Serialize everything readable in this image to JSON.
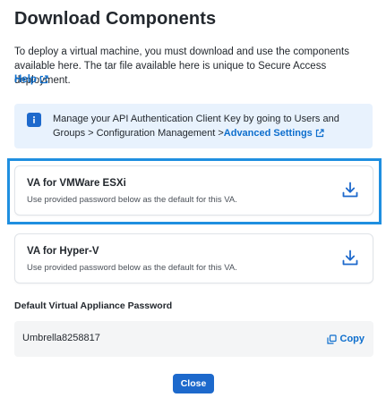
{
  "modal": {
    "title": "Download Components",
    "intro": "To deploy a virtual machine, you must download and use the components available here. The tar file available here is unique to Secure Access deployment.",
    "help_link": "Help"
  },
  "info_banner": {
    "text": "Manage your API Authentication Client Key by going to Users and Groups > Configuration Management >",
    "link": "Advanced Settings"
  },
  "components": [
    {
      "title": "VA for VMWare ESXi",
      "description": "Use provided password below as the default for this VA.",
      "highlighted": true
    },
    {
      "title": "VA for Hyper-V",
      "description": "Use provided password below as the default for this VA.",
      "highlighted": false
    }
  ],
  "password": {
    "label": "Default Virtual Appliance Password",
    "value": "Umbrella8258817",
    "copy_label": "Copy"
  },
  "footer": {
    "close_label": "Close"
  },
  "icons": {
    "info": "info-icon",
    "external_link": "external-link-icon",
    "download": "download-icon",
    "copy": "copy-icon"
  },
  "colors": {
    "accent": "#1d69cc",
    "link": "#0d6ecd",
    "highlight_border": "#1f8fe0",
    "banner_bg": "#e8f2fd",
    "password_bg": "#f4f5f6"
  }
}
